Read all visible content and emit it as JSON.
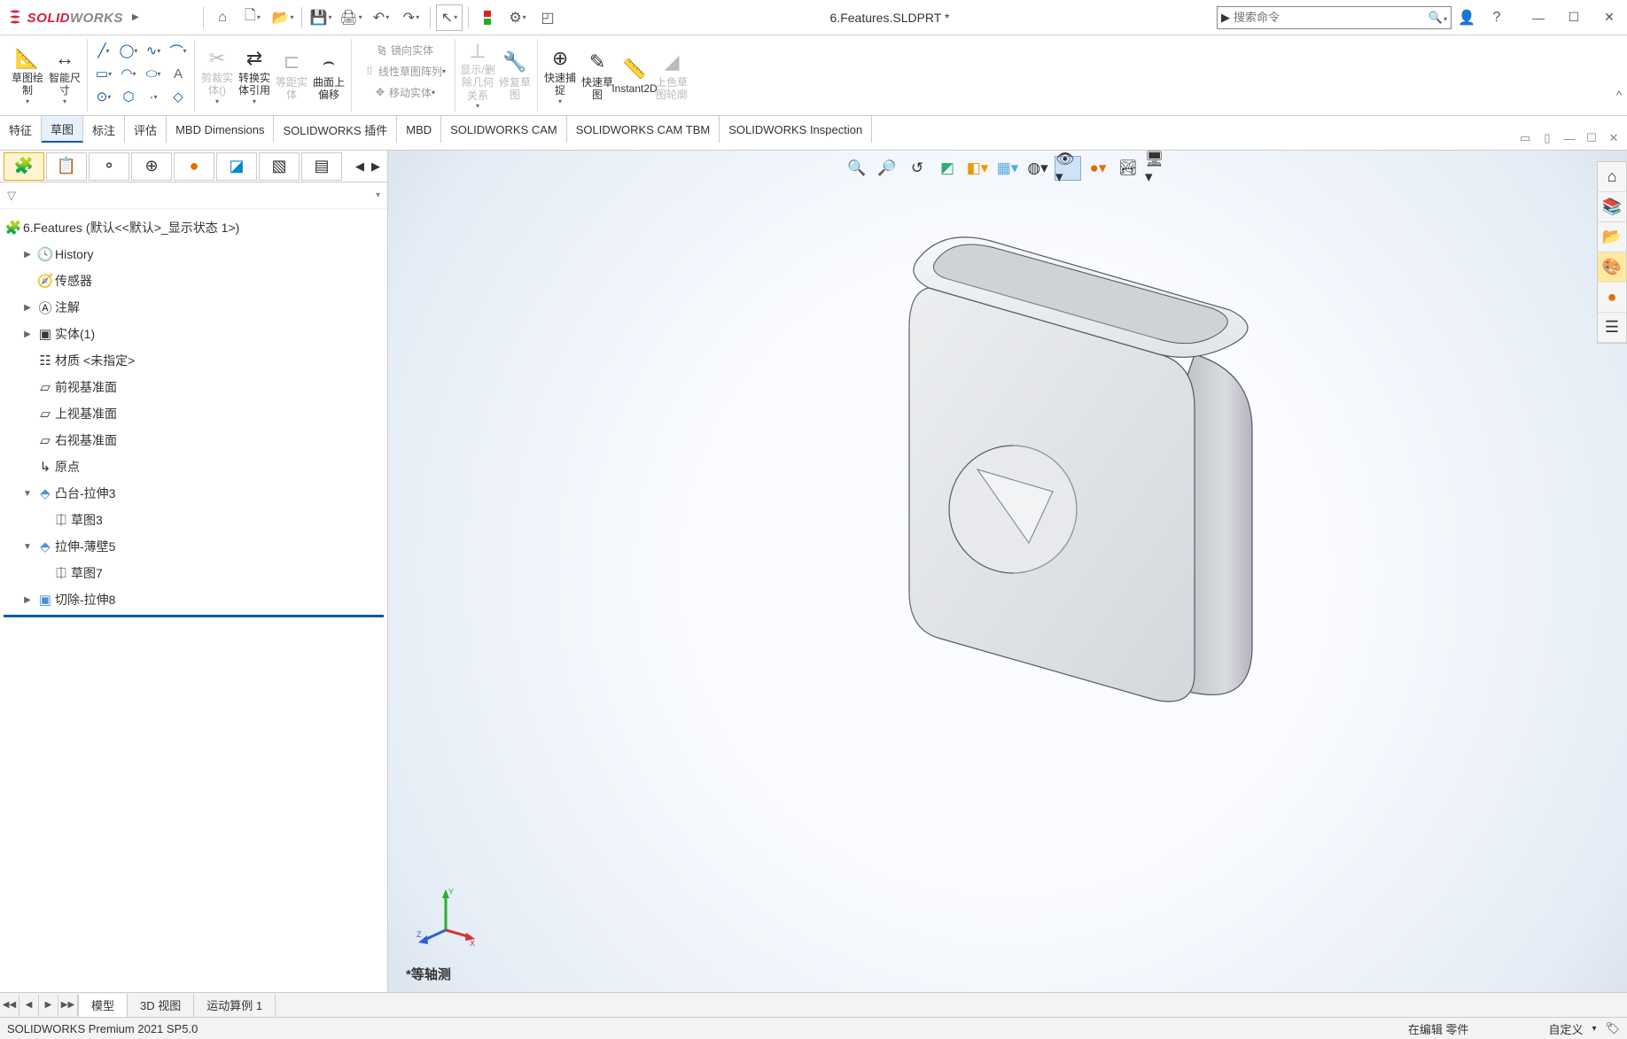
{
  "app_name_bold": "SOLID",
  "app_name_light": "WORKS",
  "document_title": "6.Features.SLDPRT *",
  "search": {
    "placeholder": "搜索命令"
  },
  "ribbon": {
    "sketch": "草图绘制",
    "smart_dim": "智能尺寸",
    "trim": "剪裁实体()",
    "convert": "转换实体引用",
    "offset_ent": "等距实体",
    "offset_surf": "曲面上偏移",
    "mirror": "镜向实体",
    "linear_pattern": "线性草图阵列",
    "move": "移动实体",
    "show_rel": "显示/删除几何关系",
    "repair": "修复草图",
    "quick_snap": "快速捕捉",
    "rapid_sketch": "快速草图",
    "instant2d": "Instant2D",
    "shade": "上色草图轮廓"
  },
  "tabs": [
    "特征",
    "草图",
    "标注",
    "评估",
    "MBD Dimensions",
    "SOLIDWORKS 插件",
    "MBD",
    "SOLIDWORKS CAM",
    "SOLIDWORKS CAM TBM",
    "SOLIDWORKS Inspection"
  ],
  "active_tab_index": 1,
  "tree": {
    "root": "6.Features  (默认<<默认>_显示状态 1>)",
    "history": "History",
    "sensors": "传感器",
    "annotations": "注解",
    "solid_bodies": "实体(1)",
    "material": "材质 <未指定>",
    "front_plane": "前视基准面",
    "top_plane": "上视基准面",
    "right_plane": "右视基准面",
    "origin": "原点",
    "boss_extrude": "凸台-拉伸3",
    "sketch3": "草图3",
    "thin_extrude": "拉伸-薄壁5",
    "sketch7": "草图7",
    "cut_extrude": "切除-拉伸8"
  },
  "view_label": "*等轴测",
  "triad": {
    "x": "X",
    "y": "Y",
    "z": "Z"
  },
  "bottom_tabs": [
    "模型",
    "3D 视图",
    "运动算例 1"
  ],
  "status": {
    "left": "SOLIDWORKS Premium 2021 SP5.0",
    "editing": "在编辑 零件",
    "custom": "自定义",
    "arrow": "▾"
  }
}
